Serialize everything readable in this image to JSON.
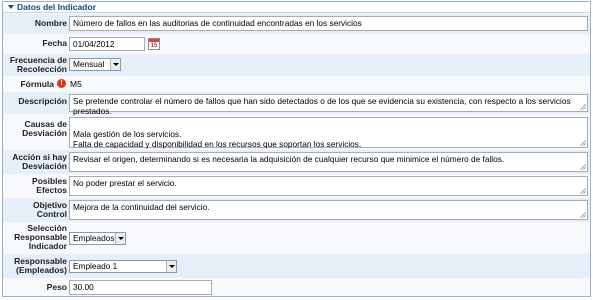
{
  "panel": {
    "title": "Datos del Indicador"
  },
  "fields": {
    "nombre": {
      "label": "Nombre",
      "value": "Número de fallos en las auditorias de continuidad encontradas en los servicios"
    },
    "fecha": {
      "label": "Fecha",
      "value": "01/04/2012",
      "calendar_glyph": "15"
    },
    "frecuencia": {
      "label": "Frecuencia de Recolección",
      "value": "Mensual"
    },
    "formula": {
      "label": "Fórmula",
      "value": "M5",
      "alert_glyph": "!"
    },
    "descripcion": {
      "label": "Descripción",
      "value": "Se pretende controlar el número de fallos que han sido detectados o de los que se evidencia su existencia, con respecto a los servicios prestados."
    },
    "causas": {
      "label": "Causas de Desviación",
      "value": "Mala gestión de los servicios.\nFalta de capacidad y disponibilidad en los recursos que soportan los servicios."
    },
    "accion": {
      "label": "Acción si hay Desviación",
      "value": "Revisar el origen, determinando si es necesaria la adquisición de cualquier recurso que minimice el número de fallos."
    },
    "efectos": {
      "label": "Posibles Efectos",
      "value": "No poder prestar el servicio."
    },
    "objetivo": {
      "label": "Objetivo Control",
      "value": "Mejora de la continuidad del servicio."
    },
    "seleccion": {
      "label": "Selección Responsable Indicador",
      "value": "Empleados"
    },
    "responsable": {
      "label": "Responsable (Empleados)",
      "value": "Empleado 1"
    },
    "peso": {
      "label": "Peso",
      "value": "30.00"
    }
  },
  "colors": {
    "header_text": "#15428b",
    "row_shade": "#e6eef8",
    "border": "#9ab1cf"
  }
}
